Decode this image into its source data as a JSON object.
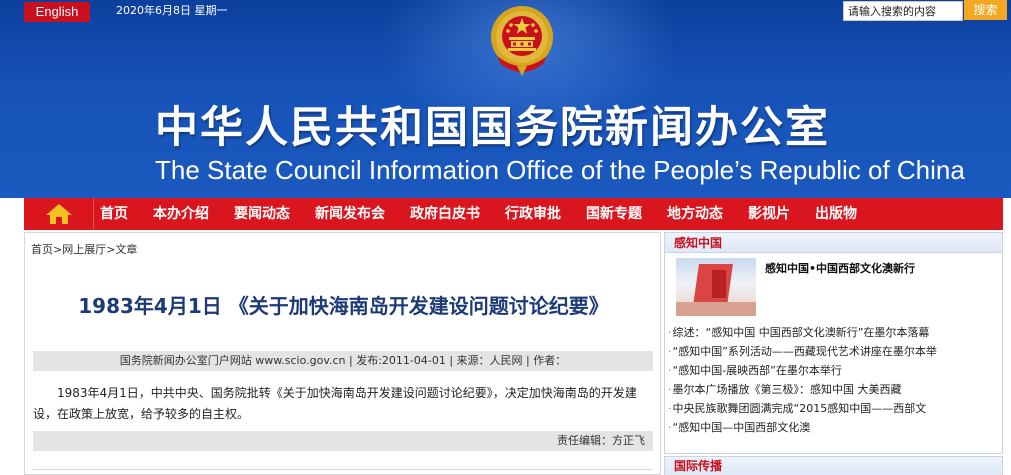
{
  "header": {
    "english_label": "English",
    "date": "2020年6月8日 星期一",
    "search_placeholder": "请输入搜索的内容",
    "search_button": "搜索",
    "title_cn": "中华人民共和国国务院新闻办公室",
    "title_en": "The State Council Information Office of the People’s Republic of China"
  },
  "nav": {
    "items": [
      "首页",
      "本办介绍",
      "要闻动态",
      "新闻发布会",
      "政府白皮书",
      "行政审批",
      "国新专题",
      "地方动态",
      "影视片",
      "出版物"
    ]
  },
  "breadcrumb": "首页>网上展厅>文章",
  "article": {
    "title": "1983年4月1日 《关于加快海南岛开发建设问题讨论纪要》",
    "meta": "国务院新闻办公室门户网站 www.scio.gov.cn | 发布:2011-04-01 | 来源：人民网 | 作者：",
    "body": "1983年4月1日，中共中央、国务院批转《关于加快海南岛开发建设问题讨论纪要》，决定加快海南岛的开发建设，在政策上放宽，给予较多的自主权。",
    "editor": "责任编辑：方正飞"
  },
  "sidebar": {
    "panel_title": "感知中国",
    "feature_title": "感知中国•中国西部文化澳新行",
    "news": [
      "综述：“感知中国 中国西部文化澳新行”在墨尔本落幕",
      "“感知中国”系列活动——西藏现代艺术讲座在墨尔本举",
      "“感知中国-展映西部”在墨尔本举行",
      "墨尔本广场播放《第三极》：感知中国 大美西藏",
      "中央民族歌舞团圆满完成“2015感知中国——西部文",
      "“感知中国—中国西部文化澳"
    ],
    "panel2_title": "国际传播"
  },
  "colors": {
    "header_blue": "#1753b8",
    "nav_red": "#d9151e",
    "english_red": "#c8101e",
    "search_orange": "#f5a623",
    "title_navy": "#1d3a78"
  }
}
